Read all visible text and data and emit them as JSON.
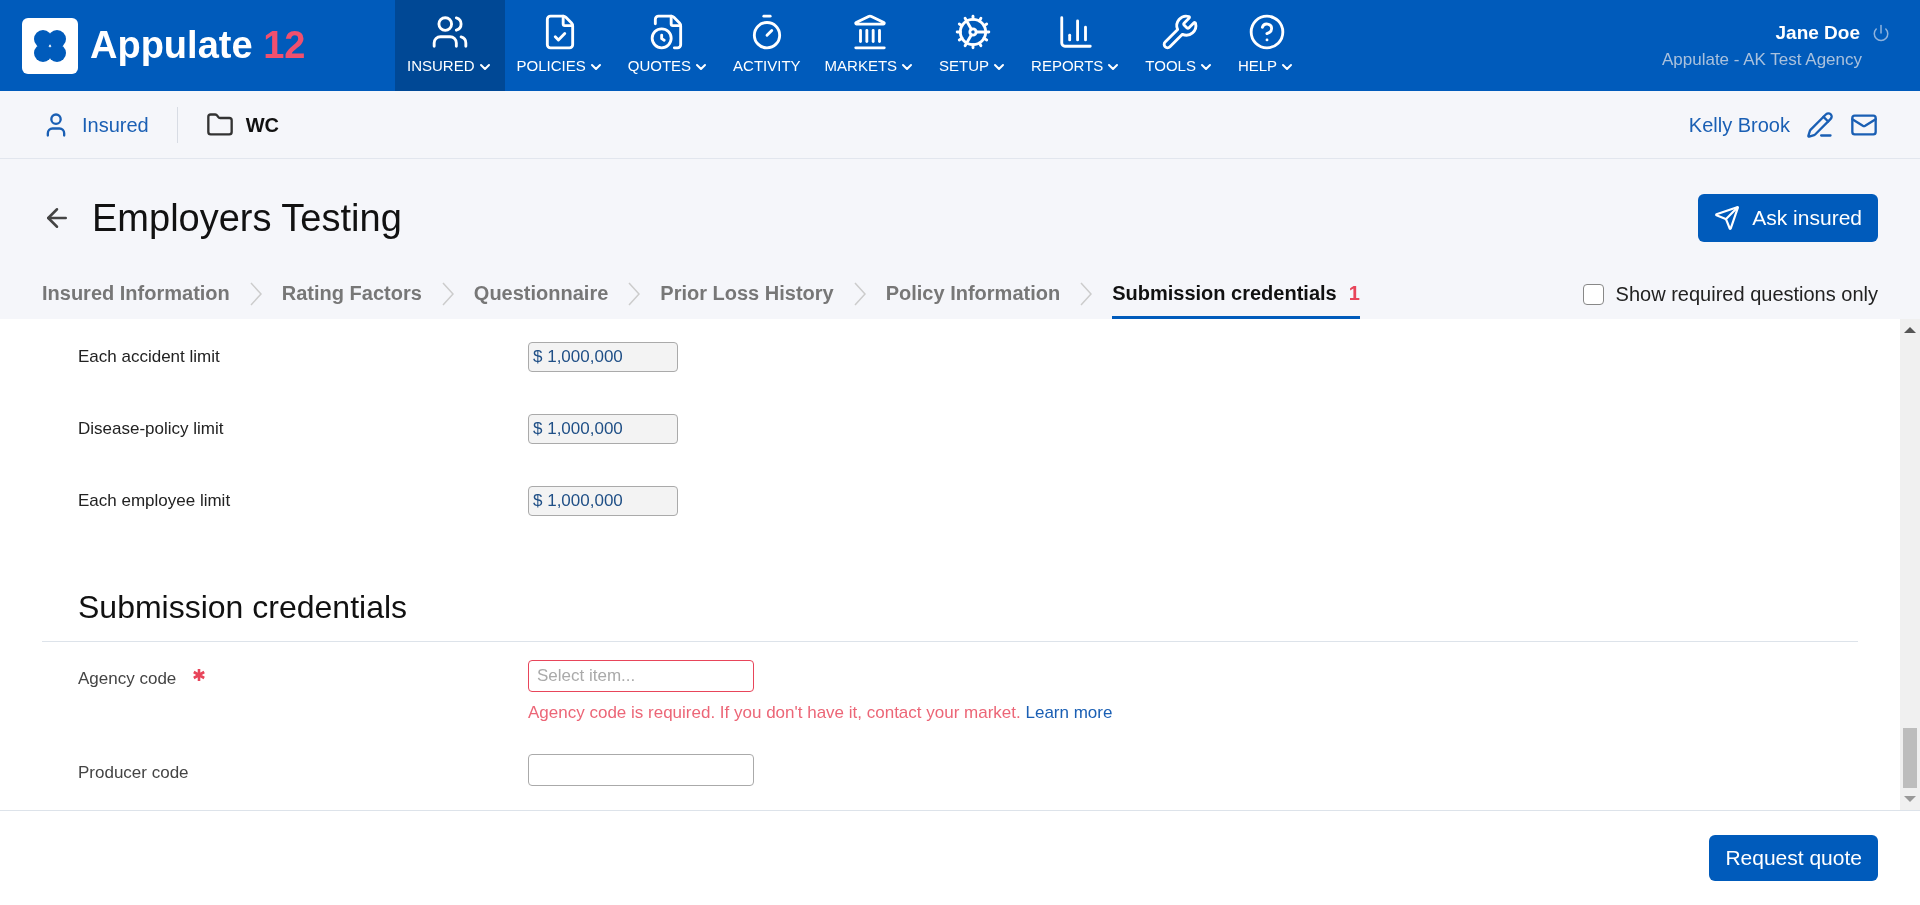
{
  "header": {
    "logo": {
      "name": "Appulate",
      "version": "12"
    },
    "nav": [
      {
        "kind": "insured",
        "label": "INSURED",
        "selected": true,
        "dropdown": true
      },
      {
        "kind": "policies",
        "label": "POLICIES",
        "selected": false,
        "dropdown": true
      },
      {
        "kind": "quotes",
        "label": "QUOTES",
        "selected": false,
        "dropdown": true
      },
      {
        "kind": "activity",
        "label": "ACTIVITY",
        "selected": false,
        "dropdown": false
      },
      {
        "kind": "markets",
        "label": "MARKETS",
        "selected": false,
        "dropdown": true
      },
      {
        "kind": "setup",
        "label": "SETUP",
        "selected": false,
        "dropdown": true
      },
      {
        "kind": "reports",
        "label": "REPORTS",
        "selected": false,
        "dropdown": true
      },
      {
        "kind": "tools",
        "label": "TOOLS",
        "selected": false,
        "dropdown": true
      },
      {
        "kind": "help",
        "label": "HELP",
        "selected": false,
        "dropdown": true
      }
    ],
    "user": {
      "name": "Jane Doe",
      "agency": "Appulate - AK Test Agency"
    }
  },
  "subheader": {
    "insured_link": "Insured",
    "folder": "WC",
    "contact": "Kelly Brook"
  },
  "page": {
    "title": "Employers Testing",
    "ask_button": "Ask insured"
  },
  "steps": [
    {
      "label": "Insured Information",
      "selected": false
    },
    {
      "label": "Rating Factors",
      "selected": false
    },
    {
      "label": "Questionnaire",
      "selected": false
    },
    {
      "label": "Prior Loss History",
      "selected": false
    },
    {
      "label": "Policy Information",
      "selected": false
    },
    {
      "label": "Submission credentials",
      "selected": true,
      "badge": "1"
    }
  ],
  "required_only": {
    "label": "Show required questions only",
    "checked": false
  },
  "limits": [
    {
      "label": "Each accident limit",
      "value": "$ 1,000,000"
    },
    {
      "label": "Disease-policy limit",
      "value": "$ 1,000,000"
    },
    {
      "label": "Each employee limit",
      "value": "$ 1,000,000"
    }
  ],
  "section": {
    "title": "Submission credentials",
    "fields": [
      {
        "label": "Agency code",
        "required": true,
        "placeholder": "Select item...",
        "error": "Agency code is required. If you don't have it, contact your market.",
        "error_link": "Learn more"
      },
      {
        "label": "Producer code",
        "required": false
      }
    ]
  },
  "footer": {
    "button": "Request quote"
  }
}
